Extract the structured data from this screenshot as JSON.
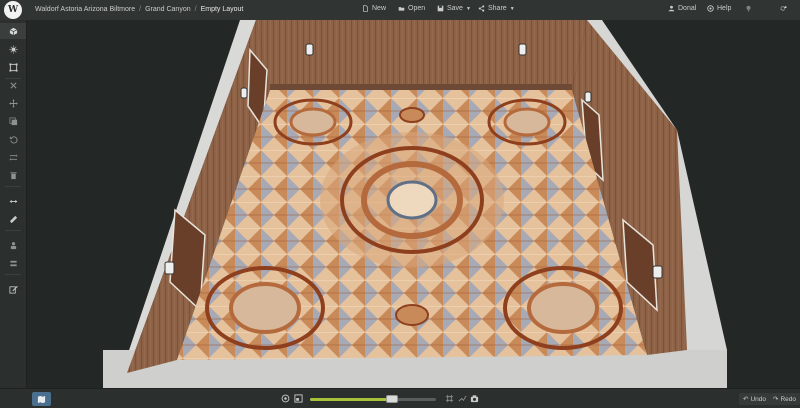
{
  "breadcrumb": {
    "venue": "Waldorf Astoria Arizona Biltmore",
    "room": "Grand Canyon",
    "layout": "Empty Layout",
    "separator": "/"
  },
  "toolbar": {
    "new_label": "New",
    "open_label": "Open",
    "save_label": "Save",
    "share_label": "Share"
  },
  "user": {
    "name": "Donal",
    "help_label": "Help"
  },
  "sidebar": {
    "items": [
      {
        "icon": "cube-icon",
        "active": true
      },
      {
        "icon": "light-icon"
      },
      {
        "icon": "select-box-icon"
      },
      {
        "icon": "close-icon"
      },
      {
        "icon": "move-icon"
      },
      {
        "icon": "copy-icon"
      },
      {
        "icon": "undo-icon"
      },
      {
        "icon": "swap-icon"
      },
      {
        "icon": "trash-icon"
      },
      {
        "icon": "measure-icon"
      },
      {
        "icon": "ruler-icon"
      },
      {
        "icon": "people-icon"
      },
      {
        "icon": "stack-icon"
      },
      {
        "icon": "edit-icon"
      }
    ]
  },
  "bottombar": {
    "zoom_level": 0.65,
    "undo_label": "Undo",
    "redo_label": "Redo"
  },
  "colors": {
    "accent": "#a7c33a",
    "map_button": "#4a6f8f",
    "wall": "#8a5f43",
    "floor_light": "#e9c7a0",
    "floor_dark": "#b5643a"
  }
}
